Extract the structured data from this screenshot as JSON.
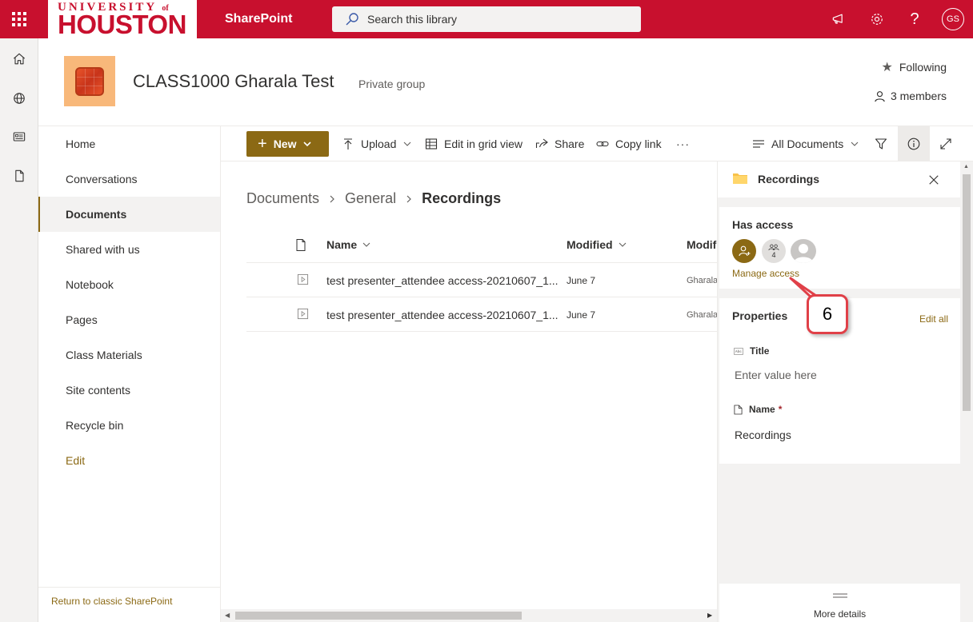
{
  "topbar": {
    "logo_top": "UNIVERSITY",
    "logo_of": "of",
    "logo_main": "HOUSTON",
    "app_name": "SharePoint",
    "search_placeholder": "Search this library",
    "avatar_initials": "GS"
  },
  "site": {
    "title": "CLASS1000 Gharala Test",
    "subtitle": "Private group",
    "following": "Following",
    "members": "3 members"
  },
  "nav": {
    "items": [
      "Home",
      "Conversations",
      "Documents",
      "Shared with us",
      "Notebook",
      "Pages",
      "Class Materials",
      "Site contents",
      "Recycle bin"
    ],
    "active": "Documents",
    "edit": "Edit",
    "return_classic": "Return to classic SharePoint"
  },
  "commands": {
    "new": "New",
    "upload": "Upload",
    "grid_view": "Edit in grid view",
    "share": "Share",
    "copy_link": "Copy link",
    "more": "···",
    "view": "All Documents"
  },
  "breadcrumb": [
    "Documents",
    "General",
    "Recordings"
  ],
  "list": {
    "columns": [
      "Name",
      "Modified",
      "Modif"
    ],
    "rows": [
      {
        "name": "test presenter_attendee access-20210607_1...",
        "modified": "June 7",
        "by": "Gharala"
      },
      {
        "name": "test presenter_attendee access-20210607_1...",
        "modified": "June 7",
        "by": "Gharala"
      }
    ]
  },
  "pane": {
    "title": "Recordings",
    "has_access": "Has access",
    "access_count": "4",
    "manage_access": "Manage access",
    "properties": "Properties",
    "edit_all": "Edit all",
    "title_label": "Title",
    "title_placeholder": "Enter value here",
    "name_label": "Name",
    "name_required": "*",
    "name_value": "Recordings",
    "more_details": "More details"
  },
  "callout": "6",
  "colors": {
    "brand_red": "#c8102e",
    "accent_gold": "#8b6914",
    "callout_border": "#e04048"
  }
}
